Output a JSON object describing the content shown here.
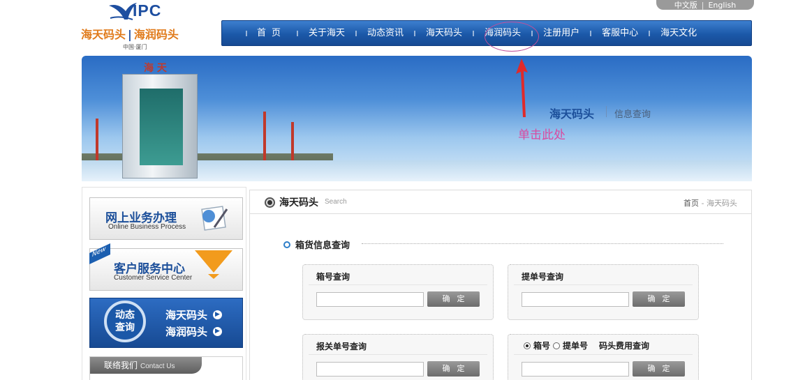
{
  "header": {
    "lang": {
      "zh": "中文版",
      "separator": "|",
      "en": "English"
    },
    "logo": {
      "brand": "IPC",
      "name1": "海天码头",
      "divider": "|",
      "name2": "海润码头",
      "place": "中国·厦门"
    }
  },
  "nav": {
    "items": [
      "首页",
      "关于海天",
      "动态资讯",
      "海天码头",
      "海润码头",
      "注册用户",
      "客服中心",
      "海天文化"
    ]
  },
  "banner": {
    "title": "海天码头",
    "subtitle": "信息查询",
    "annotation": "单击此处",
    "sign": "海 天"
  },
  "sidebar": {
    "online": {
      "cn": "网上业务办理",
      "en": "Online Business Process"
    },
    "service": {
      "badge": "New",
      "cn": "客户服务中心",
      "en": "Customer Service Center"
    },
    "dynamic": {
      "label": "动态查询",
      "label_line1": "动态",
      "label_line2": "查询",
      "links": [
        "海天码头",
        "海润码头"
      ]
    },
    "contact": {
      "cn": "联络我们",
      "en": "Contact Us"
    }
  },
  "main": {
    "heading": "海天码头",
    "heading_sub": "Search",
    "breadcrumb": {
      "home": "首页",
      "sep": " - ",
      "current": "海天码头"
    },
    "section_title": "箱货信息查询",
    "boxes": [
      {
        "title": "箱号查询",
        "input": "",
        "button": "确定"
      },
      {
        "title": "提单号查询",
        "input": "",
        "button": "确定"
      },
      {
        "title": "报关单号查询",
        "input": "",
        "button": "确定"
      },
      {
        "radio1": "箱号",
        "radio2": "提单号",
        "title": "码头费用查询",
        "selected": "箱号",
        "input": "",
        "button": "确定"
      }
    ]
  },
  "colors": {
    "nav_blue": "#1b58a8",
    "annotation_pink": "#d94aa0",
    "orange": "#f29b1d"
  }
}
